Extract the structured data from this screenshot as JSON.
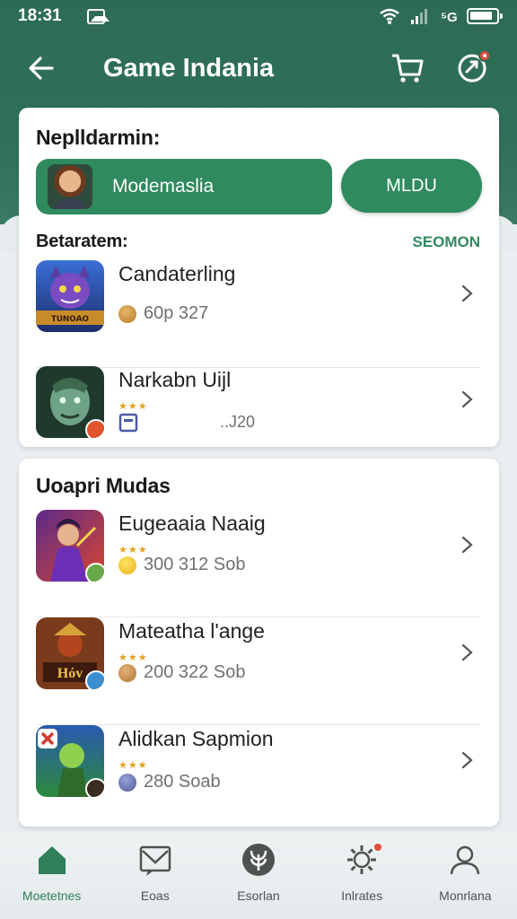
{
  "status_bar": {
    "time": "18:31"
  },
  "app_bar": {
    "title": "Game Indania"
  },
  "card1": {
    "section_title": "Neplldarmin:",
    "profile_name": "Modemaslia",
    "action_button": "MLDU",
    "list_title": "Betaratem:",
    "see_more": "SEOMON",
    "games": [
      {
        "name": "Candaterling",
        "price": "60p 327"
      },
      {
        "name": "Narkabn Uijl",
        "price": "..J20",
        "stars": "★★★"
      }
    ]
  },
  "card2": {
    "section_title": "Uoapri Mudas",
    "games": [
      {
        "name": "Eugeaaia Naaig",
        "stars": "★★★",
        "price": "300 312 Sob"
      },
      {
        "name": "Mateatha l'ange",
        "stars": "★★★",
        "price": "200 322 Sob"
      },
      {
        "name": "Alidkan Sapmion",
        "stars": "★★★",
        "price": "280 Soab"
      }
    ]
  },
  "bottom_nav": [
    {
      "label": "Moetetnes",
      "icon": "home-icon",
      "active": true
    },
    {
      "label": "Eoas",
      "icon": "mail-icon"
    },
    {
      "label": "Esorlan",
      "icon": "leaf-icon"
    },
    {
      "label": "Inlrates",
      "icon": "gear-icon"
    },
    {
      "label": "Monrlana",
      "icon": "profile-icon"
    }
  ],
  "colors": {
    "primary": "#2f8a5e",
    "header": "#2e6b55",
    "accent_dot": "#e04b3c"
  }
}
